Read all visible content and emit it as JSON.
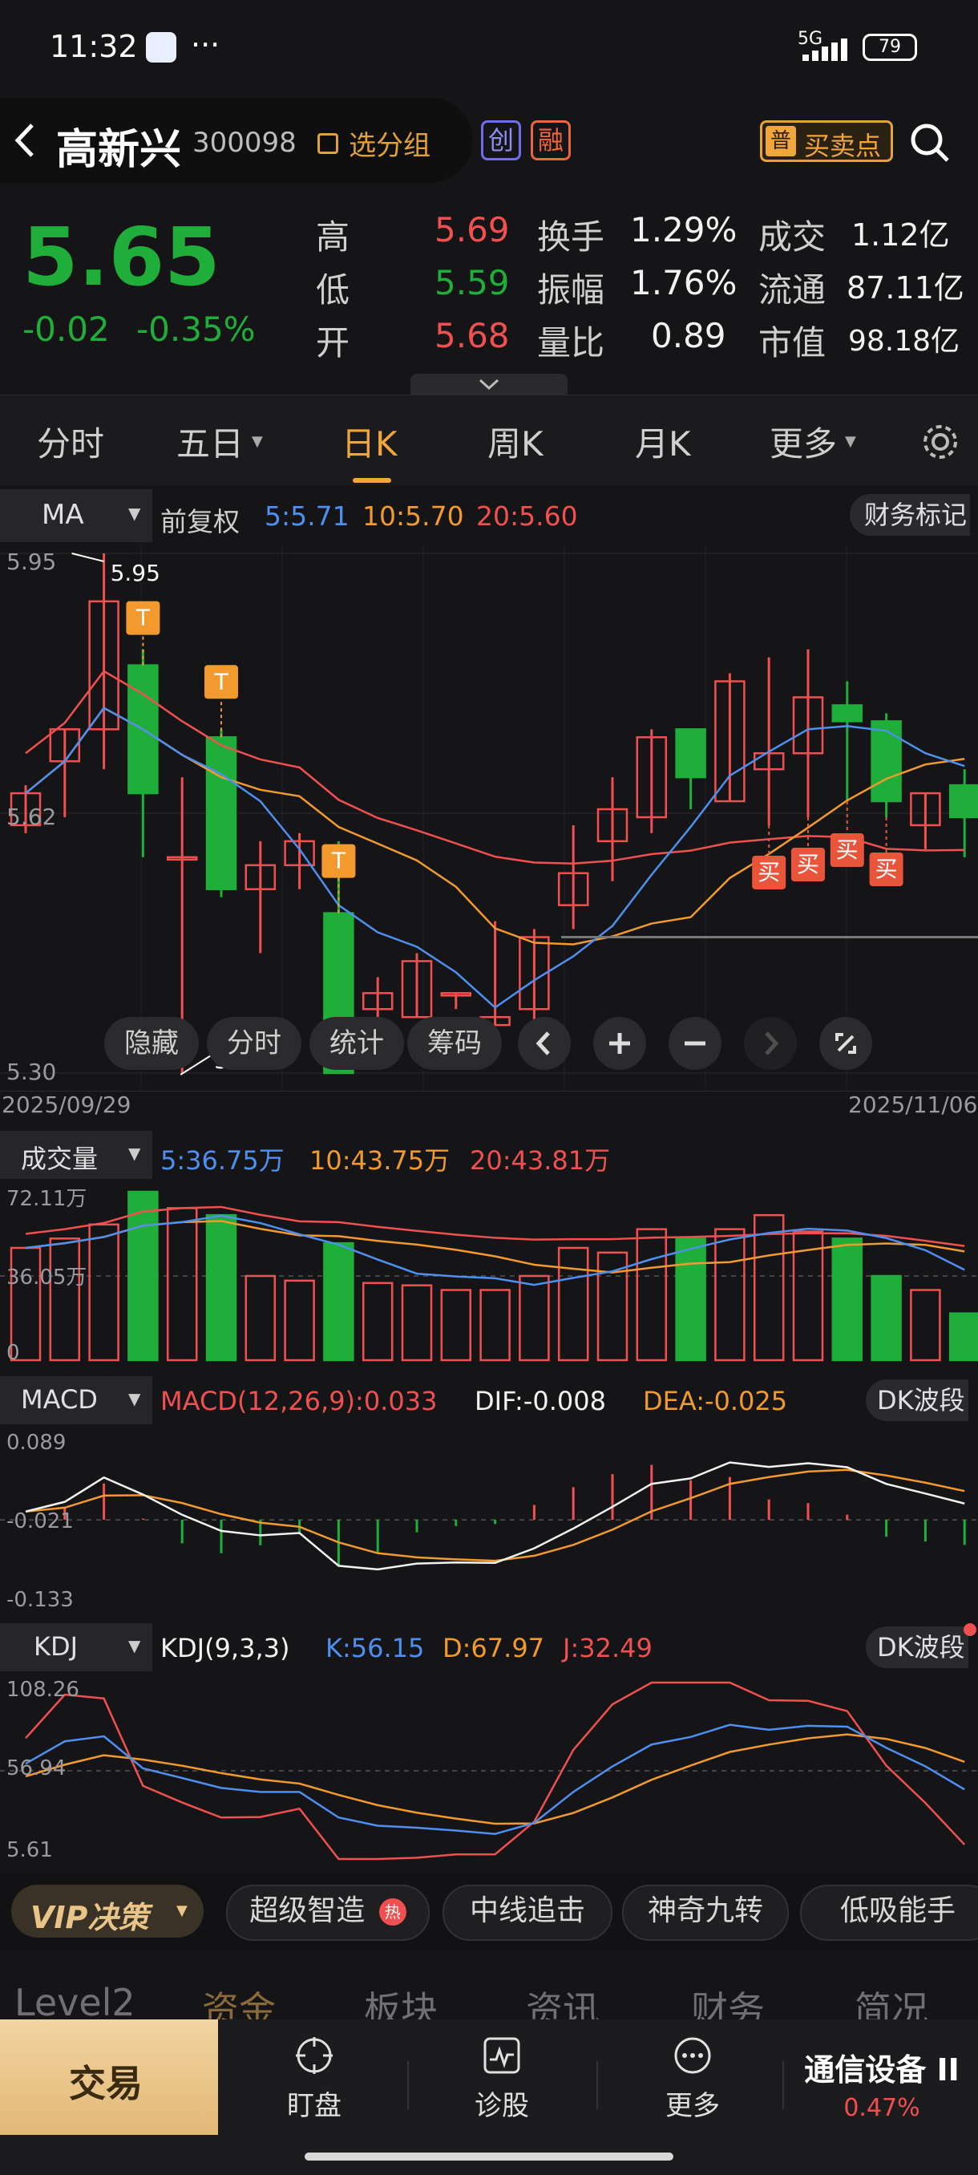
{
  "status": {
    "time": "11:32",
    "dots": "···",
    "network": "5G",
    "battery": "79"
  },
  "header": {
    "title": "高新兴",
    "code": "300098",
    "add_group": "选分组",
    "badge1": "创",
    "badge2": "融",
    "trade_point_tag": "普",
    "trade_point": "买卖点"
  },
  "quote": {
    "price": "5.65",
    "change": "-0.02",
    "change_pct": "-0.35%",
    "high_label": "高",
    "high": "5.69",
    "low_label": "低",
    "low": "5.59",
    "open_label": "开",
    "open": "5.68",
    "turnover_label": "换手",
    "turnover": "1.29%",
    "amplitude_label": "振幅",
    "amplitude": "1.76%",
    "volratio_label": "量比",
    "volratio": "0.89",
    "amount_label": "成交",
    "amount": "1.12亿",
    "float_label": "流通",
    "float": "87.11亿",
    "mcap_label": "市值",
    "mcap": "98.18亿"
  },
  "tabs": [
    "分时",
    "五日",
    "日K",
    "周K",
    "月K",
    "更多"
  ],
  "kline": {
    "ma_label": "MA",
    "adjust": "前复权",
    "ma5": "5:5.71",
    "ma10": "10:5.70",
    "ma20": "20:5.60",
    "fin_mark": "财务标记",
    "y_top": "5.95",
    "y_mid": "5.62",
    "y_bot": "5.30",
    "high_mark": "5.95",
    "low_mark": "5.30",
    "date_start": "2025/09/29",
    "date_end": "2025/11/06",
    "t_tag": "T",
    "buy_tag": "买",
    "controls": [
      "隐藏",
      "分时",
      "统计",
      "筹码"
    ]
  },
  "volume": {
    "label": "成交量",
    "ma5": "5:36.75万",
    "ma10": "10:43.75万",
    "ma20": "20:43.81万",
    "y_top": "72.11万",
    "y_mid": "36.05万",
    "y_bot": "0"
  },
  "macd": {
    "label": "MACD",
    "params": "MACD(12,26,9):0.033",
    "dif": "DIF:-0.008",
    "dea": "DEA:-0.025",
    "dk": "DK波段",
    "y_top": "0.089",
    "y_mid": "-0.021",
    "y_bot": "-0.133"
  },
  "kdj": {
    "label": "KDJ",
    "params": "KDJ(9,3,3)",
    "k": "K:56.15",
    "d": "D:67.97",
    "j": "J:32.49",
    "dk": "DK波段",
    "y_top": "108.26",
    "y_mid": "56.94",
    "y_bot": "5.61"
  },
  "vip": {
    "label": "VIP决策",
    "chips": [
      "超级智造",
      "中线追击",
      "神奇九转",
      "低吸能手"
    ],
    "hot": "热"
  },
  "lower_tabs": [
    "Level2",
    "资金",
    "板块",
    "资讯",
    "财务",
    "简况"
  ],
  "bottom": {
    "trade": "交易",
    "watch": "盯盘",
    "diagnose": "诊股",
    "more": "更多",
    "sector": "通信设备 II",
    "sector_pct": "0.47%"
  },
  "colors": {
    "up": "#f0504f",
    "down": "#1fae3a",
    "ma5": "#4e8ff0",
    "ma10": "#f29a2e",
    "ma20": "#f0504f",
    "accent": "#f0a63a"
  },
  "chart_data": {
    "type": "candlestick",
    "candles": [
      {
        "o": 5.61,
        "h": 5.66,
        "l": 5.6,
        "c": 5.65,
        "v": 48
      },
      {
        "o": 5.69,
        "h": 5.73,
        "l": 5.62,
        "c": 5.73,
        "v": 52
      },
      {
        "o": 5.73,
        "h": 5.95,
        "l": 5.68,
        "c": 5.89,
        "v": 58
      },
      {
        "o": 5.81,
        "h": 5.83,
        "l": 5.57,
        "c": 5.65,
        "v": 72
      },
      {
        "o": 5.57,
        "h": 5.67,
        "l": 5.3,
        "c": 5.57,
        "v": 65
      },
      {
        "o": 5.72,
        "h": 5.73,
        "l": 5.52,
        "c": 5.53,
        "v": 62
      },
      {
        "o": 5.53,
        "h": 5.59,
        "l": 5.45,
        "c": 5.56,
        "v": 36
      },
      {
        "o": 5.56,
        "h": 5.6,
        "l": 5.53,
        "c": 5.59,
        "v": 34
      },
      {
        "o": 5.5,
        "h": 5.59,
        "l": 5.3,
        "c": 5.3,
        "v": 50
      },
      {
        "o": 5.38,
        "h": 5.42,
        "l": 5.32,
        "c": 5.4,
        "v": 33
      },
      {
        "o": 5.37,
        "h": 5.45,
        "l": 5.37,
        "c": 5.44,
        "v": 32
      },
      {
        "o": 5.4,
        "h": 5.4,
        "l": 5.38,
        "c": 5.4,
        "v": 30
      },
      {
        "o": 5.36,
        "h": 5.49,
        "l": 5.36,
        "c": 5.37,
        "v": 30
      },
      {
        "o": 5.38,
        "h": 5.48,
        "l": 5.34,
        "c": 5.47,
        "v": 36
      },
      {
        "o": 5.51,
        "h": 5.61,
        "l": 5.48,
        "c": 5.55,
        "v": 48
      },
      {
        "o": 5.59,
        "h": 5.67,
        "l": 5.54,
        "c": 5.63,
        "v": 46
      },
      {
        "o": 5.62,
        "h": 5.73,
        "l": 5.6,
        "c": 5.72,
        "v": 56
      },
      {
        "o": 5.73,
        "h": 5.73,
        "l": 5.63,
        "c": 5.67,
        "v": 52
      },
      {
        "o": 5.64,
        "h": 5.8,
        "l": 5.64,
        "c": 5.79,
        "v": 56
      },
      {
        "o": 5.68,
        "h": 5.82,
        "l": 5.61,
        "c": 5.7,
        "v": 62
      },
      {
        "o": 5.7,
        "h": 5.83,
        "l": 5.62,
        "c": 5.77,
        "v": 55
      },
      {
        "o": 5.76,
        "h": 5.79,
        "l": 5.64,
        "c": 5.74,
        "v": 52
      },
      {
        "o": 5.74,
        "h": 5.75,
        "l": 5.62,
        "c": 5.64,
        "v": 36
      },
      {
        "o": 5.61,
        "h": 5.65,
        "l": 5.58,
        "c": 5.65,
        "v": 30
      },
      {
        "o": 5.66,
        "h": 5.68,
        "l": 5.57,
        "c": 5.62,
        "v": 20
      }
    ],
    "ylim": [
      5.3,
      5.95
    ],
    "x_start": "2025/09/29",
    "x_end": "2025/11/06"
  }
}
